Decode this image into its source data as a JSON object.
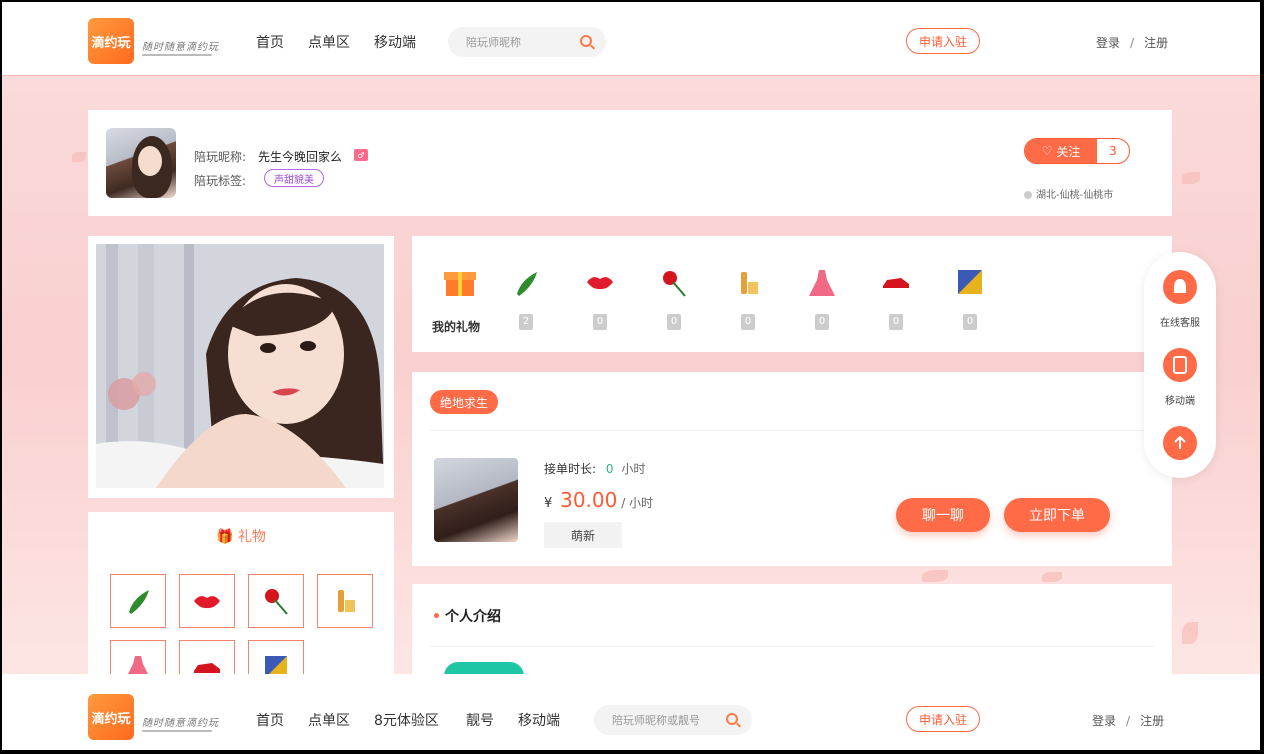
{
  "header": {
    "logo_text": "滴约玩",
    "slogan": "随时随意滴约玩",
    "nav": [
      "首页",
      "点单区",
      "移动端"
    ],
    "search_placeholder": "陪玩师昵称",
    "apply_label": "申请入驻",
    "login_label": "登录",
    "separator": "/",
    "register_label": "注册"
  },
  "profile": {
    "nickname_label": "陪玩昵称:",
    "nickname": "先生今晚回家么",
    "tags_label": "陪玩标签:",
    "tag": "声甜貌美",
    "follow_label": "关注",
    "follow_count": "3",
    "location": "湖北-仙桃-仙桃市"
  },
  "gift_panel": {
    "title": "礼物",
    "items": [
      "cucumber-gift",
      "lips-gift",
      "rose-gift",
      "champagne-gift",
      "dress-gift",
      "car-gift",
      "painting-gift"
    ]
  },
  "my_gifts": {
    "label": "我的礼物",
    "items": [
      {
        "icon": "cucumber-gift",
        "count": "2"
      },
      {
        "icon": "lips-gift",
        "count": "0"
      },
      {
        "icon": "rose-gift",
        "count": "0"
      },
      {
        "icon": "champagne-gift",
        "count": "0"
      },
      {
        "icon": "dress-gift",
        "count": "0"
      },
      {
        "icon": "car-gift",
        "count": "0"
      },
      {
        "icon": "painting-gift",
        "count": "0"
      }
    ]
  },
  "service": {
    "game": "绝地求生",
    "duration_label": "接单时长:",
    "duration_value": "0",
    "duration_unit": "小时",
    "currency": "¥",
    "price": "30.00",
    "price_unit": "/ 小时",
    "level": "萌新",
    "chat_label": "聊一聊",
    "order_label": "立即下单"
  },
  "intro": {
    "title": "个人介绍"
  },
  "side": {
    "service_label": "在线客服",
    "mobile_label": "移动端"
  },
  "footer": {
    "logo_text": "滴约玩",
    "slogan": "随时随意滴约玩",
    "nav": [
      "首页",
      "点单区",
      "8元体验区",
      "靓号",
      "移动端"
    ],
    "search_placeholder": "陪玩师昵称或靓号",
    "apply_label": "申请入驻",
    "login_label": "登录",
    "separator": "/",
    "register_label": "注册"
  },
  "colors": {
    "accent": "#ff6a47",
    "background": "#fbd4d4",
    "tag_purple": "#9a4fd8",
    "duration_green": "#2fb37a"
  }
}
